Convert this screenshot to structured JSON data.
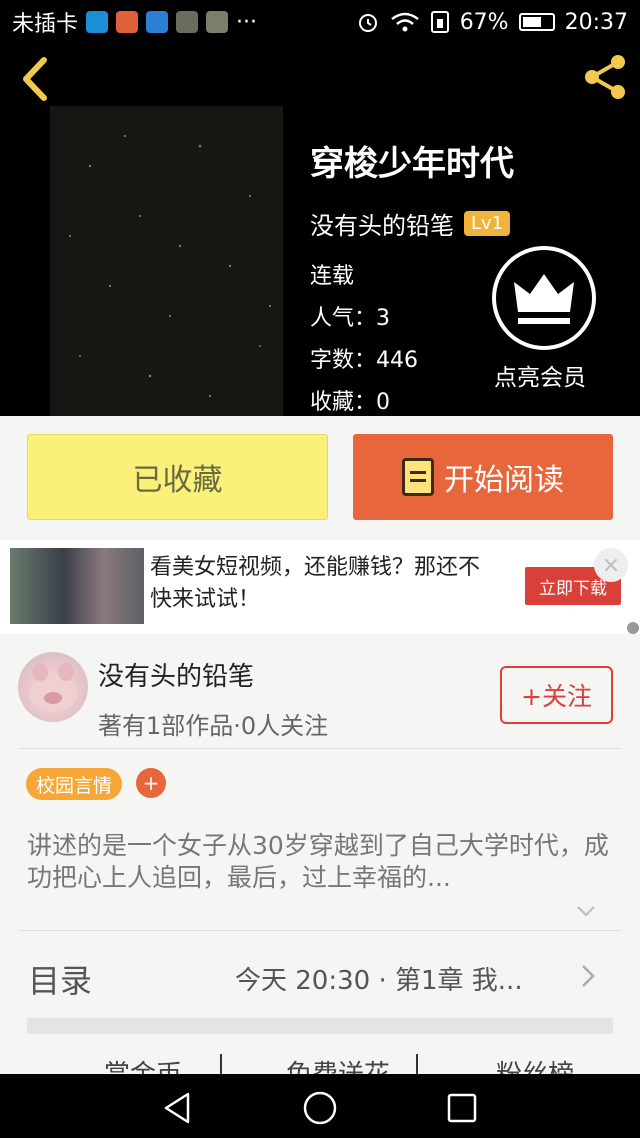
{
  "status_bar": {
    "carrier": "未插卡",
    "battery_pct": "67%",
    "battery_level": 0.67,
    "time": "20:37",
    "more": "···"
  },
  "book": {
    "title": "穿梭少年时代",
    "author": "没有头的铅笔",
    "level": "Lv1",
    "status": "连载",
    "popularity_label": "人气：",
    "popularity": "3",
    "words_label": "字数：",
    "words": "446",
    "favorites_label": "收藏：",
    "favorites": "0"
  },
  "vip": {
    "label": "点亮会员"
  },
  "actions": {
    "collected_label": "已收藏",
    "read_label": "开始阅读"
  },
  "ad": {
    "text": "看美女短视频，还能赚钱？那还不快来试试！",
    "cta": "立即下载",
    "close": "×"
  },
  "author_card": {
    "name": "没有头的铅笔",
    "stats": "著有1部作品·0人关注",
    "follow_label": "+关注"
  },
  "tags": {
    "items": [
      "校园言情"
    ],
    "add": "+"
  },
  "summary": "讲述的是一个女子从30岁穿越到了自己大学时代，成功把心上人追回，最后，过上幸福的...",
  "toc": {
    "label": "目录",
    "latest": "今天 20:30 · 第1章  我..."
  },
  "bottom_tabs": [
    "赏金币",
    "免费送花",
    "粉丝榜"
  ],
  "colors": {
    "accent_orange": "#e8663b",
    "collected_yellow": "#fbf17a",
    "tag_orange": "#f7a638",
    "follow_red": "#d9403a",
    "icon_yellow": "#f2c94c"
  }
}
